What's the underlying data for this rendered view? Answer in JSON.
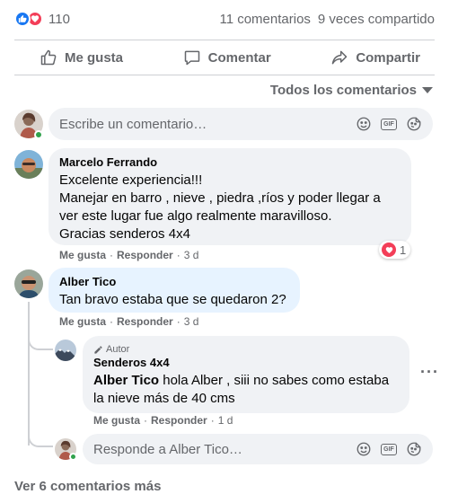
{
  "reactions": {
    "count": "110",
    "icons": [
      "like-icon",
      "love-icon"
    ],
    "like_color": "#1877f2",
    "love_color": "#f33e58"
  },
  "stats": {
    "comments": "11 comentarios",
    "shares": "9 veces compartido"
  },
  "actions": {
    "like": "Me gusta",
    "comment": "Comentar",
    "share": "Compartir"
  },
  "sort": {
    "label": "Todos los comentarios"
  },
  "composer": {
    "placeholder": "Escribe un comentario…"
  },
  "comments": [
    {
      "author": "Marcelo Ferrando",
      "lines": [
        "Excelente experiencia!!!",
        "Manejar en barro , nieve , piedra ,ríos y poder llegar a",
        "ver este lugar fue algo realmente maravilloso.",
        "Gracias senderos 4x4"
      ],
      "like": "Me gusta",
      "reply": "Responder",
      "time": "3 d",
      "reaction_count": "1"
    },
    {
      "author": "Alber Tico",
      "text": "Tan bravo estaba que se quedaron 2?",
      "like": "Me gusta",
      "reply": "Responder",
      "time": "3 d",
      "replies": [
        {
          "badge": "Autor",
          "author": "Senderos 4x4",
          "mention": "Alber Tico",
          "text_line1": " hola Alber , siii no sabes como estaba",
          "text_line2": "la nieve más de 40 cms",
          "like": "Me gusta",
          "reply": "Responder",
          "time": "1 d"
        }
      ]
    }
  ],
  "reply_composer": {
    "placeholder": "Responde a Alber Tico…"
  },
  "view_more": "Ver 6 comentarios más",
  "separator": "·"
}
